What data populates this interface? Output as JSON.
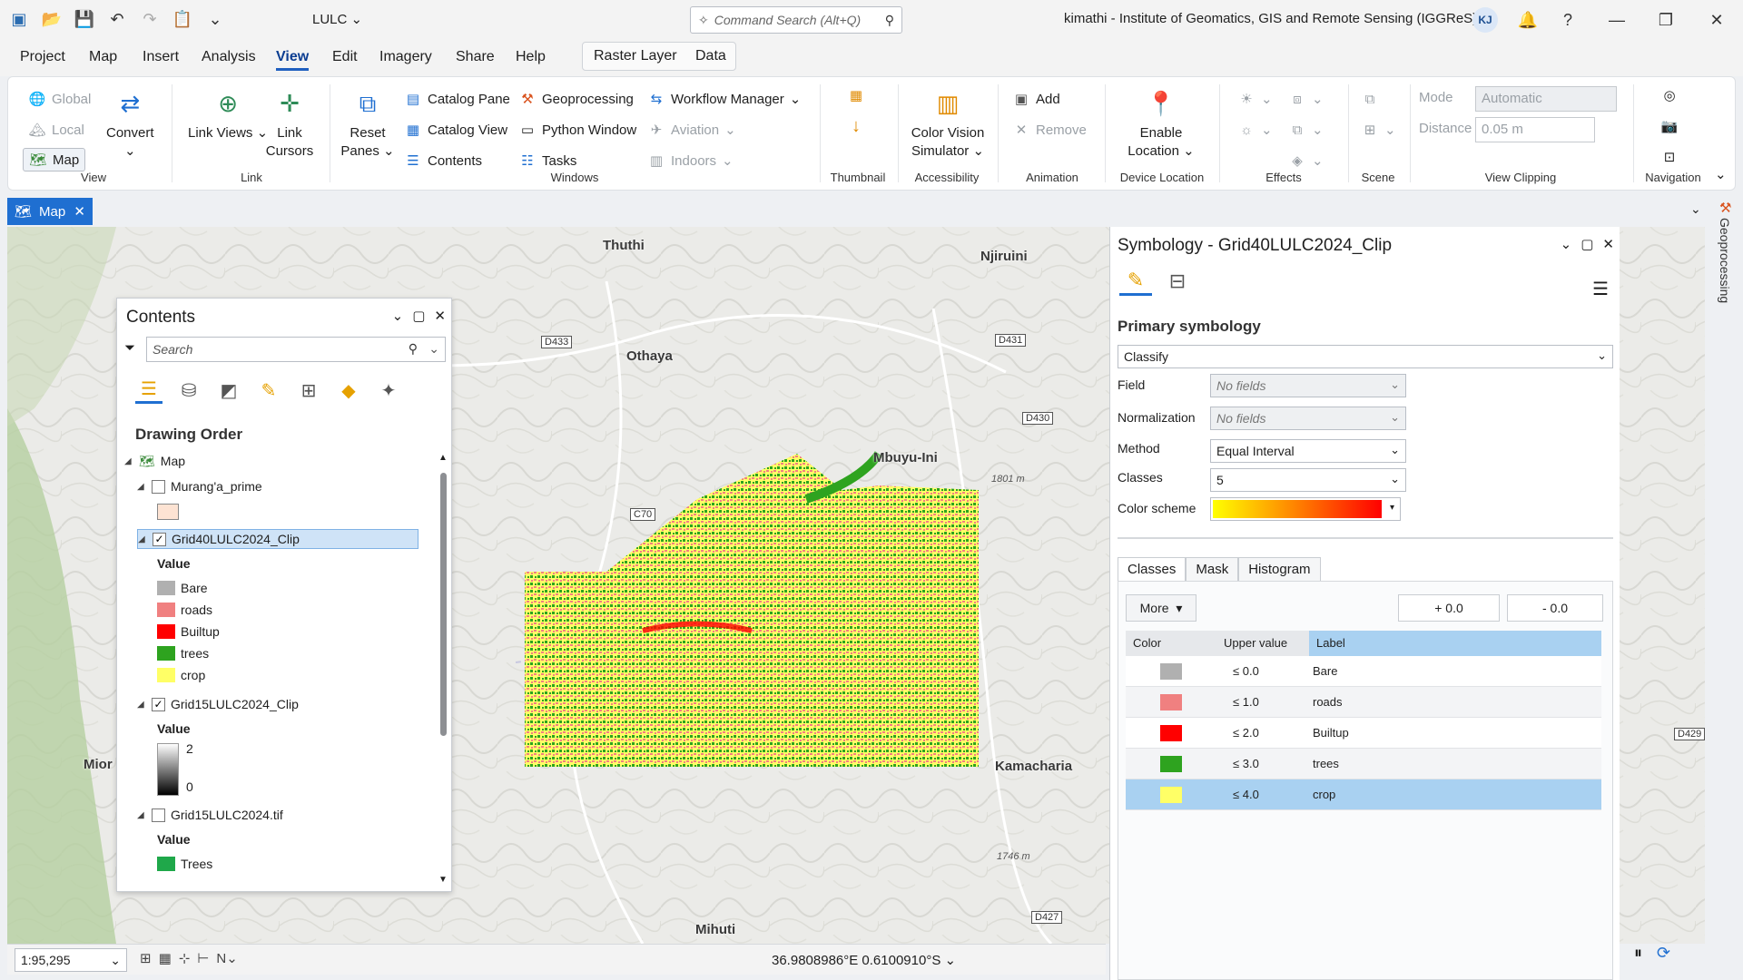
{
  "title": {
    "project": "LULC",
    "command_search_placeholder": "Command Search (Alt+Q)",
    "account": "kimathi - Institute of Geomatics, GIS and Remote Sensing (IGGReS)",
    "avatar": "KJ"
  },
  "menu": {
    "tabs": [
      "Project",
      "Map",
      "Insert",
      "Analysis",
      "View",
      "Edit",
      "Imagery",
      "Share",
      "Help"
    ],
    "active": "View",
    "context_tabs": [
      "Raster Layer",
      "Data"
    ]
  },
  "ribbon": {
    "view": {
      "global": "Global",
      "local": "Local",
      "map": "Map",
      "convert": "Convert",
      "title": "View"
    },
    "link": {
      "link_views": "Link Views",
      "link_cursors": "Link Cursors",
      "title": "Link"
    },
    "windows": {
      "reset_panes": "Reset Panes",
      "catalog_pane": "Catalog Pane",
      "catalog_view": "Catalog View",
      "contents": "Contents",
      "geoprocessing": "Geoprocessing",
      "python_window": "Python Window",
      "tasks": "Tasks",
      "workflow_manager": "Workflow Manager",
      "aviation": "Aviation",
      "indoors": "Indoors",
      "title": "Windows"
    },
    "thumbnail": {
      "title": "Thumbnail"
    },
    "accessibility": {
      "color_vision": "Color Vision Simulator",
      "title": "Accessibility"
    },
    "animation": {
      "add": "Add",
      "remove": "Remove",
      "title": "Animation"
    },
    "device_location": {
      "enable": "Enable Location",
      "title": "Device Location"
    },
    "effects": {
      "title": "Effects"
    },
    "scene": {
      "title": "Scene"
    },
    "view_clipping": {
      "mode_label": "Mode",
      "mode_value": "Automatic",
      "distance_label": "Distance",
      "distance_value": "0.05 m",
      "title": "View Clipping"
    },
    "navigation": {
      "title": "Navigation"
    }
  },
  "map_tab": {
    "label": "Map"
  },
  "map": {
    "places": [
      "Thuthi",
      "Njiruini",
      "Othaya",
      "Mbuyu-Ini",
      "Kamacharia",
      "Mihuti",
      "Mior"
    ],
    "roads": [
      "D433",
      "D431",
      "D430",
      "C70",
      "D429",
      "D427"
    ],
    "elevations": [
      "1801 m",
      "1746 m"
    ]
  },
  "contents": {
    "title": "Contents",
    "search_placeholder": "Search",
    "drawing_order": "Drawing Order",
    "map_label": "Map",
    "layers": [
      {
        "name": "Murang'a_prime",
        "checked": false
      },
      {
        "name": "Grid40LULC2024_Clip",
        "checked": true
      },
      {
        "name": "Grid15LULC2024_Clip",
        "checked": true
      },
      {
        "name": "Grid15LULC2024.tif",
        "checked": false
      }
    ],
    "value_label": "Value",
    "classes": [
      {
        "label": "Bare",
        "color": "#b0b0b0"
      },
      {
        "label": "roads",
        "color": "#f08080"
      },
      {
        "label": "Builtup",
        "color": "#ff0000"
      },
      {
        "label": "trees",
        "color": "#2ea31f"
      },
      {
        "label": "crop",
        "color": "#ffff66"
      }
    ],
    "grid15_stretch": {
      "max": "2",
      "min": "0"
    },
    "grid15tif_class": {
      "label": "Trees",
      "color": "#1fa84a"
    }
  },
  "symbology": {
    "title": "Symbology - Grid40LULC2024_Clip",
    "primary": "Primary symbology",
    "renderer": "Classify",
    "field_label": "Field",
    "field_value": "No fields",
    "normalization_label": "Normalization",
    "normalization_value": "No fields",
    "method_label": "Method",
    "method_value": "Equal Interval",
    "classes_label": "Classes",
    "classes_value": "5",
    "color_scheme_label": "Color scheme",
    "subtabs": [
      "Classes",
      "Mask",
      "Histogram"
    ],
    "more": "More",
    "plus": "+ 0.0",
    "minus": "- 0.0",
    "headers": {
      "color": "Color",
      "upper": "Upper value",
      "label": "Label"
    },
    "rows": [
      {
        "upper": "≤   0.0",
        "label": "Bare",
        "color": "#b0b0b0"
      },
      {
        "upper": "≤   1.0",
        "label": "roads",
        "color": "#f08080"
      },
      {
        "upper": "≤   2.0",
        "label": "Builtup",
        "color": "#ff0000"
      },
      {
        "upper": "≤   3.0",
        "label": "trees",
        "color": "#2ea31f"
      },
      {
        "upper": "≤   4.0",
        "label": "crop",
        "color": "#ffff66"
      }
    ]
  },
  "geoprocessing_label": "Geoprocessing",
  "status": {
    "scale": "1:95,295",
    "coords": "36.9808986°E 0.6100910°S"
  }
}
